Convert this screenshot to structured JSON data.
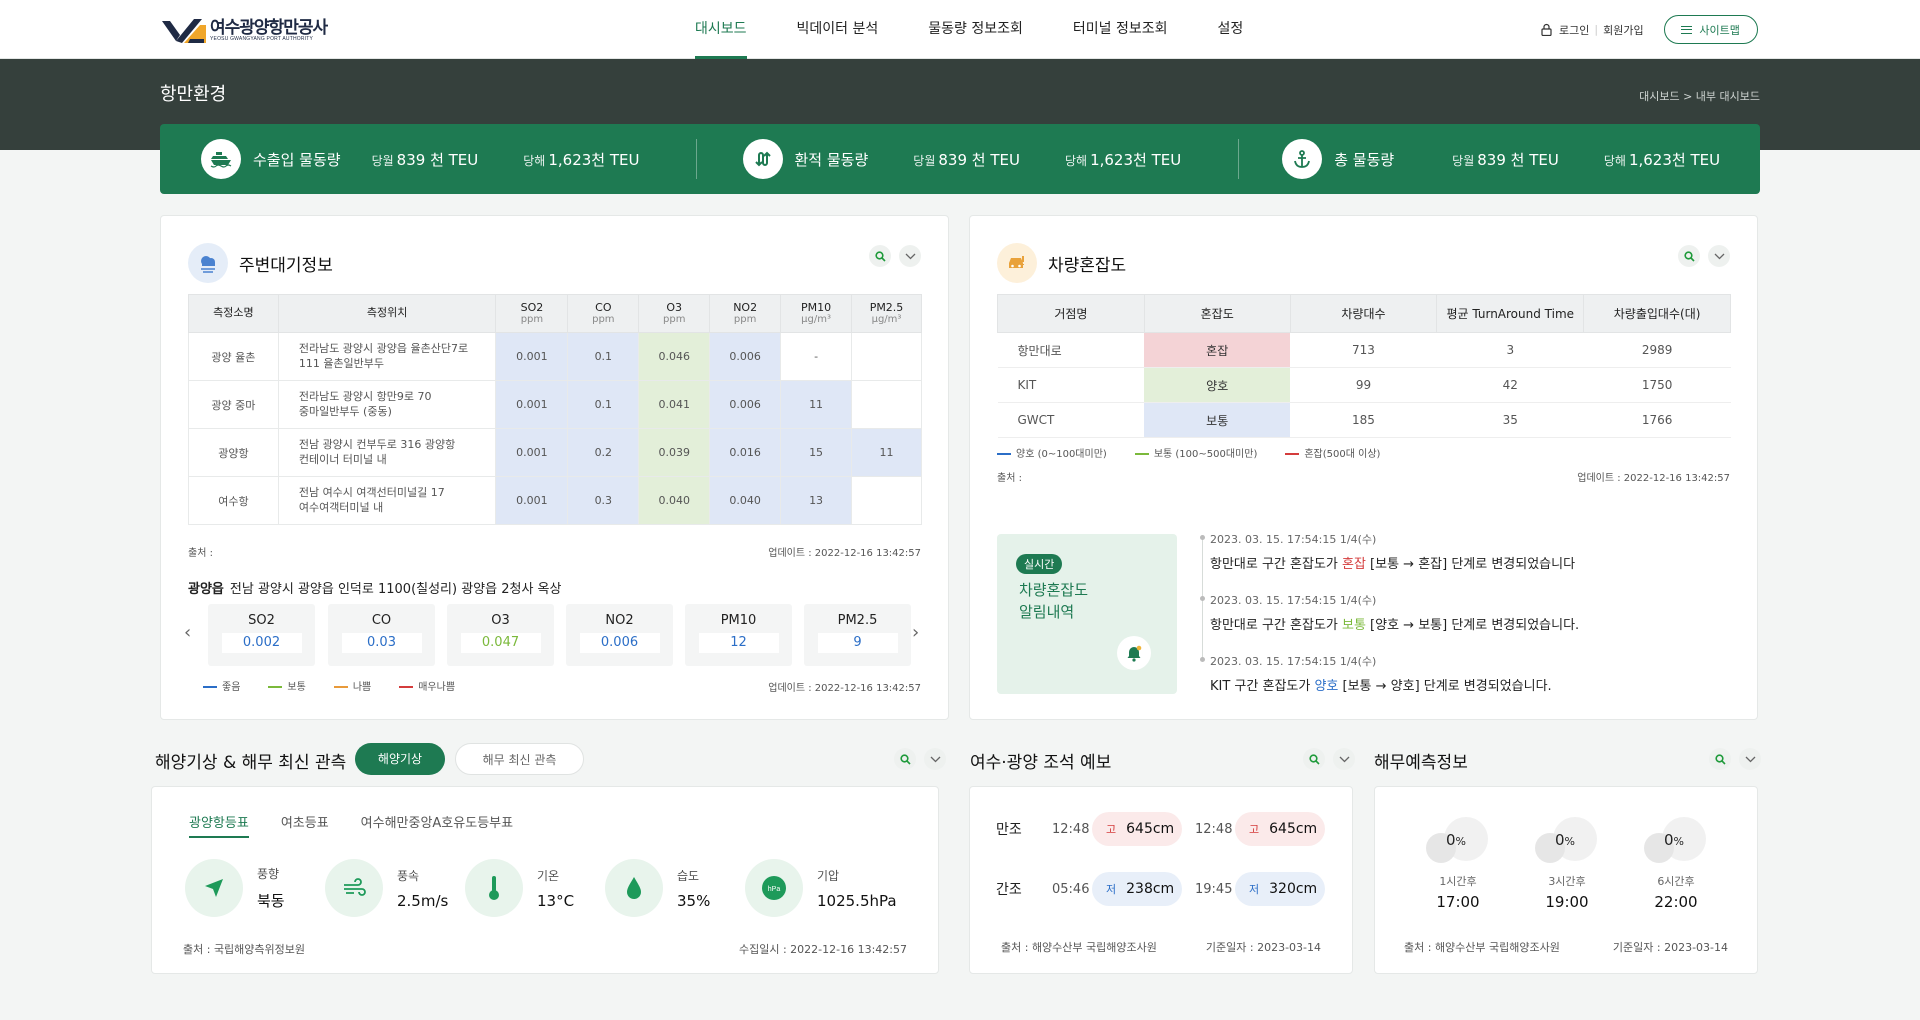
{
  "header": {
    "logo_ko": "여수광양항만공사",
    "logo_en": "YEOSU GWANGYANG PORT AUTHORITY",
    "nav": [
      "대시보드",
      "빅데이터 분석",
      "물동량 정보조회",
      "터미널 정보조회",
      "설정"
    ],
    "login": "로그인",
    "signup": "회원가입",
    "sitemap": "사이트맵"
  },
  "band": {
    "title": "항만환경",
    "breadcrumb": "대시보드 > 내부 대시보드"
  },
  "stats": [
    {
      "name": "수출입 물동량",
      "month_label": "당월",
      "month_value": "839 천 TEU",
      "year_label": "당해",
      "year_value": "1,623천 TEU",
      "icon": "ship-icon"
    },
    {
      "name": "환적 물동량",
      "month_label": "당월",
      "month_value": "839 천 TEU",
      "year_label": "당해",
      "year_value": "1,623천 TEU",
      "icon": "transfer-icon"
    },
    {
      "name": "총 물동량",
      "month_label": "당월",
      "month_value": "839 천 TEU",
      "year_label": "당해",
      "year_value": "1,623천 TEU",
      "icon": "anchor-icon"
    }
  ],
  "air": {
    "title": "주변대기정보",
    "headers": [
      "측정소명",
      "측정위치",
      "SO2",
      "CO",
      "O3",
      "NO2",
      "PM10",
      "PM2.5"
    ],
    "units": [
      "",
      "",
      "ppm",
      "ppm",
      "ppm",
      "ppm",
      "μg/m³",
      "μg/m³"
    ],
    "rows": [
      {
        "station": "광양 율촌",
        "loc1": "전라남도 광양시 광양읍 율촌산단7로",
        "loc2": "111 율촌일반부두",
        "so2": "0.001",
        "co": "0.1",
        "o3": "0.046",
        "no2": "0.006",
        "pm10": "-",
        "pm25": ""
      },
      {
        "station": "광양 중마",
        "loc1": "전라남도 광양시 항만9로 70",
        "loc2": "중마일반부두 (중동)",
        "so2": "0.001",
        "co": "0.1",
        "o3": "0.041",
        "no2": "0.006",
        "pm10": "11",
        "pm25": ""
      },
      {
        "station": "광양항",
        "loc1": "전남 광양시 컨부두로 316 광양항",
        "loc2": "컨테이너 터미널 내",
        "so2": "0.001",
        "co": "0.2",
        "o3": "0.039",
        "no2": "0.016",
        "pm10": "15",
        "pm25": "11"
      },
      {
        "station": "여수항",
        "loc1": "전남 여수시 여객선터미널길 17",
        "loc2": "여수여객터미널 내",
        "so2": "0.001",
        "co": "0.3",
        "o3": "0.040",
        "no2": "0.040",
        "pm10": "13",
        "pm25": ""
      }
    ],
    "source": "출처 :",
    "updated": "업데이트 : 2022-12-16 13:42:57",
    "station_name": "광양읍",
    "station_addr": "전남 광양시 광양읍 인덕로 1100(칠성리) 광양읍 2청사 옥상",
    "pollutants": [
      {
        "name": "SO2",
        "value": "0.002",
        "color": "#2b6ec7"
      },
      {
        "name": "CO",
        "value": "0.03",
        "color": "#2b6ec7"
      },
      {
        "name": "O3",
        "value": "0.047",
        "color": "#7bb93b"
      },
      {
        "name": "NO2",
        "value": "0.006",
        "color": "#2b6ec7"
      },
      {
        "name": "PM10",
        "value": "12",
        "color": "#2b6ec7"
      },
      {
        "name": "PM2.5",
        "value": "9",
        "color": "#2b6ec7"
      }
    ],
    "legend": [
      {
        "label": "좋음",
        "color": "#2b6ec7"
      },
      {
        "label": "보통",
        "color": "#7bb93b"
      },
      {
        "label": "나쁨",
        "color": "#e89a3a"
      },
      {
        "label": "매우나쁨",
        "color": "#d43c3c"
      }
    ],
    "updated2": "업데이트 : 2022-12-16 13:42:57"
  },
  "traffic": {
    "title": "차량혼잡도",
    "headers": [
      "거점명",
      "혼잡도",
      "차량대수",
      "평균 TurnAround Time",
      "차량출입대수(대)"
    ],
    "rows": [
      {
        "name": "항만대로",
        "level": "혼잡",
        "level_class": "l-red",
        "count": "713",
        "tat": "3",
        "inout": "2989"
      },
      {
        "name": "KIT",
        "level": "양호",
        "level_class": "l-green",
        "count": "99",
        "tat": "42",
        "inout": "1750"
      },
      {
        "name": "GWCT",
        "level": "보통",
        "level_class": "l-blue",
        "count": "185",
        "tat": "35",
        "inout": "1766"
      }
    ],
    "legend": [
      {
        "label": "양호 (0~100대미만)",
        "color": "#2b6ec7"
      },
      {
        "label": "보통 (100~500대미만)",
        "color": "#7bb93b"
      },
      {
        "label": "혼잡(500대 이상)",
        "color": "#d43c3c"
      }
    ],
    "source": "출처 :",
    "updated": "업데이트 : 2022-12-16 13:42:57",
    "live_badge": "실시간",
    "alert_title1": "차량혼잡도",
    "alert_title2": "알림내역",
    "alerts": [
      {
        "time": "2023. 03. 15. 17:54:15 1/4(수)",
        "pre": "항만대로 구간 혼잡도가 ",
        "word": "혼잡",
        "word_color": "#d43c3c",
        "post": " [보통 → 혼잡] 단계로 변경되었습니다"
      },
      {
        "time": "2023. 03. 15. 17:54:15 1/4(수)",
        "pre": "항만대로 구간 혼잡도가 ",
        "word": "보통",
        "word_color": "#7bb93b",
        "post": " [양호 → 보통] 단계로 변경되었습니다."
      },
      {
        "time": "2023. 03. 15. 17:54:15 1/4(수)",
        "pre": "KIT 구간 혼잡도가 ",
        "word": "양호",
        "word_color": "#2b6ec7",
        "post": " [보통 → 양호] 단계로 변경되었습니다."
      }
    ]
  },
  "marine": {
    "title": "해양기상 & 해무 최신 관측",
    "pill_on": "해양기상",
    "pill_off": "해무 최신 관측",
    "tabs": [
      "광양항등표",
      "여초등표",
      "여수해만중앙A호유도등부표"
    ],
    "items": [
      {
        "label": "풍향",
        "value": "북동",
        "icon": "wind-direction-icon"
      },
      {
        "label": "풍속",
        "value": "2.5m/s",
        "icon": "wind-speed-icon"
      },
      {
        "label": "기온",
        "value": "13°C",
        "icon": "thermometer-icon"
      },
      {
        "label": "습도",
        "value": "35%",
        "icon": "humidity-icon"
      },
      {
        "label": "기압",
        "value": "1025.5hPa",
        "icon": "pressure-icon"
      }
    ],
    "hpa": "hPa",
    "source": "출처 :  국립해양측위정보원",
    "collected": "수집일시 : 2022-12-16 13:42:57"
  },
  "tide": {
    "title": "여수·광양 조석 예보",
    "rows": [
      {
        "kind": "만조",
        "t1": "12:48",
        "tag1": "고",
        "v1": "645cm",
        "t2": "12:48",
        "tag2": "고",
        "v2": "645cm",
        "chip": "chip-r"
      },
      {
        "kind": "간조",
        "t1": "05:46",
        "tag1": "저",
        "v1": "238cm",
        "t2": "19:45",
        "tag2": "저",
        "v2": "320cm",
        "chip": "chip-b"
      }
    ],
    "source": "출처 :  해양수산부 국립해양조사원",
    "base": "기준일자 : 2023-03-14"
  },
  "fog": {
    "title": "해무예측정보",
    "items": [
      {
        "pct": "0",
        "unit": "%",
        "when": "1시간후",
        "hour": "17:00"
      },
      {
        "pct": "0",
        "unit": "%",
        "when": "3시간후",
        "hour": "19:00"
      },
      {
        "pct": "0",
        "unit": "%",
        "when": "6시간후",
        "hour": "22:00"
      }
    ],
    "source": "출처 :  해양수산부 국립해양조사원",
    "base": "기준일자 : 2023-03-14"
  }
}
